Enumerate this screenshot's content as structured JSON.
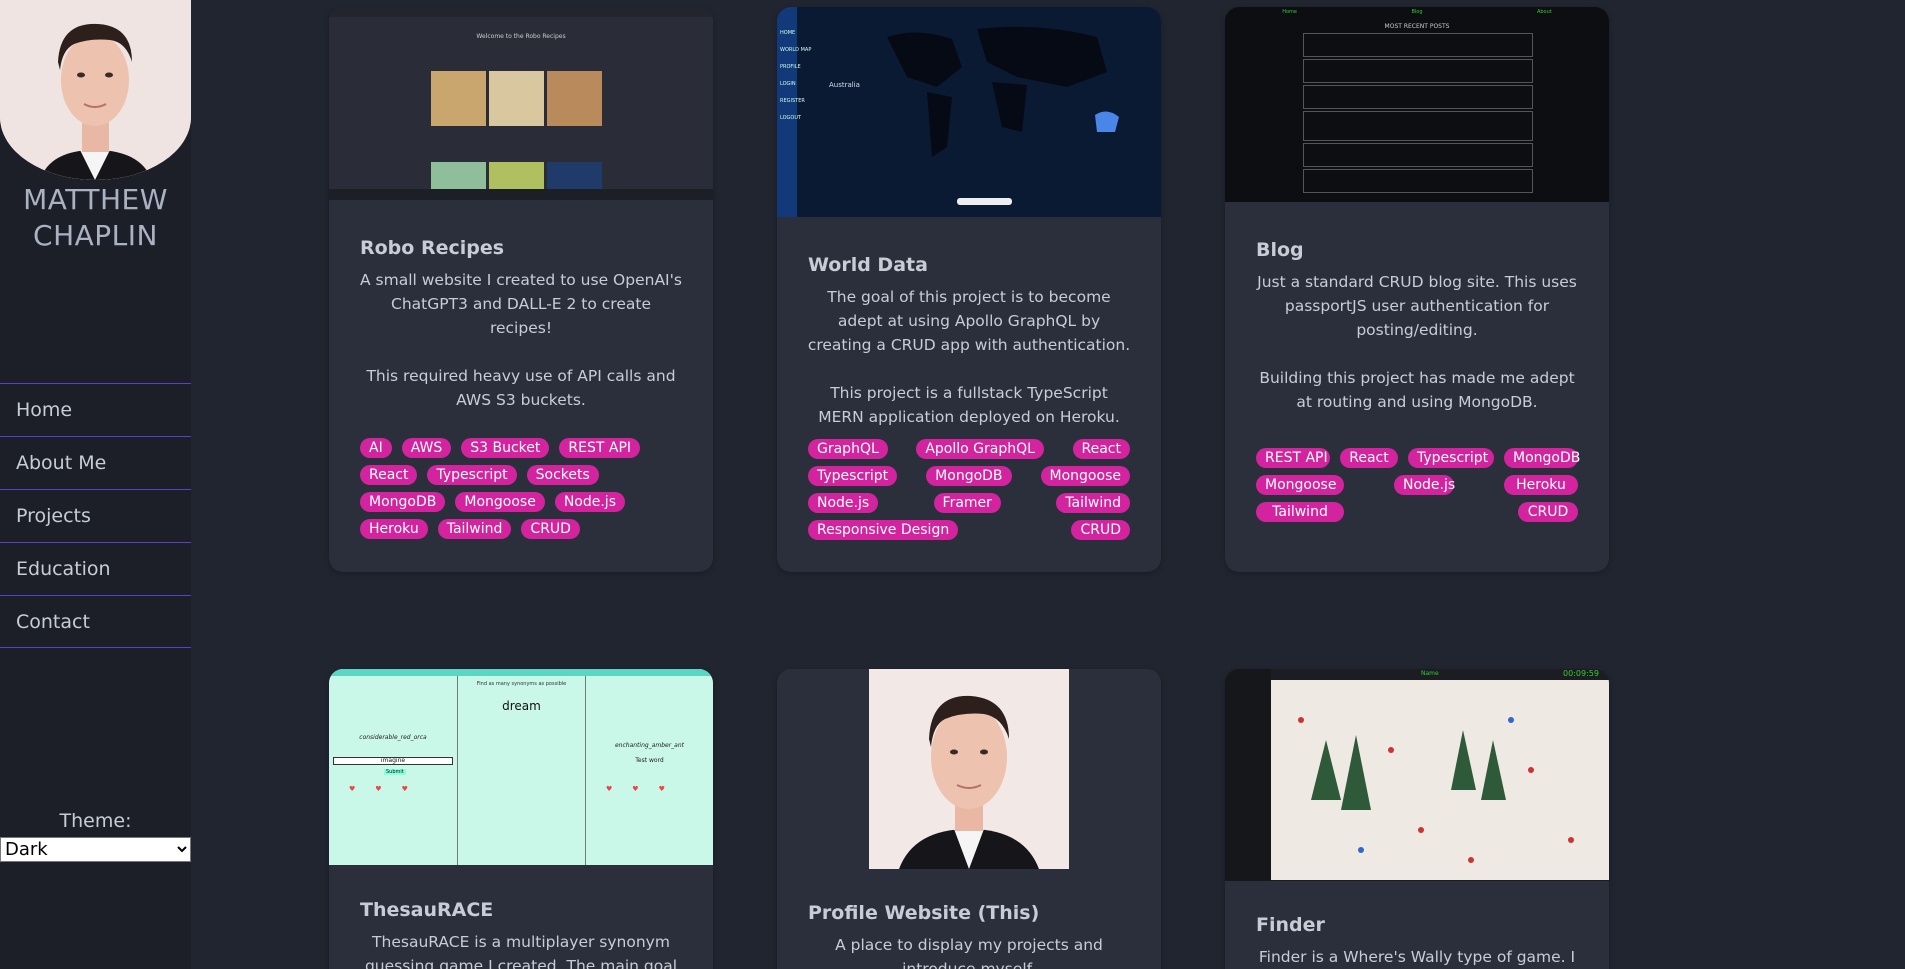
{
  "profile": {
    "name": "MATTHEW CHAPLIN"
  },
  "nav": {
    "items": [
      "Home",
      "About Me",
      "Projects",
      "Education",
      "Contact"
    ]
  },
  "theme": {
    "label": "Theme:",
    "selected": "Dark"
  },
  "projects": [
    {
      "title": "Robo Recipes",
      "desc": "A small website I created to use OpenAI's ChatGPT3 and DALL-E 2 to create recipes!\n\nThis required heavy use of API calls and AWS S3 buckets.",
      "tags": [
        "AI",
        "AWS",
        "S3 Bucket",
        "REST API",
        "React",
        "Typescript",
        "Sockets",
        "MongoDB",
        "Mongoose",
        "Node.js",
        "Heroku",
        "Tailwind",
        "CRUD"
      ],
      "shot": {
        "heading": "Welcome to the Robo Recipes"
      }
    },
    {
      "title": "World Data",
      "desc": "The goal of this project is to become adept at using Apollo GraphQL by creating a CRUD app with authentication.\n\nThis project is a fullstack TypeScript MERN application deployed on Heroku.",
      "tags": [
        "GraphQL",
        "Apollo GraphQL",
        "React",
        "Typescript",
        "MongoDB",
        "Mongoose",
        "Node.js",
        "Framer",
        "Tailwind",
        "Responsive Design",
        "CRUD"
      ],
      "shot": {
        "country": "Australia",
        "menu": [
          "HOME",
          "WORLD MAP",
          "PROFILE",
          "LOGIN",
          "REGISTER",
          "LOGOUT"
        ]
      }
    },
    {
      "title": "Blog",
      "desc": "Just a standard CRUD blog site. This uses passportJS user authentication for posting/editing.\n\nBuilding this project has made me adept at routing and using MongoDB.",
      "tags": [
        "REST API",
        "React",
        "Typescript",
        "MongoDB",
        "Mongoose",
        "Node.js",
        "Heroku",
        "Tailwind",
        "CRUD"
      ],
      "shot": {
        "nav": [
          "Home",
          "Blog",
          "About"
        ],
        "heading": "MOST RECENT POSTS"
      }
    },
    {
      "title": "ThesauRACE",
      "desc": "ThesauRACE is a multiplayer synonym guessing game I created. The main goal of",
      "tags": [],
      "shot": {
        "prompt": "Find as many synonyms as possible",
        "word": "dream",
        "left_player": "considerable_red_orca",
        "right_player": "enchanting_amber_ant",
        "input": "imagine",
        "right_word": "Test word",
        "submit": "Submit"
      }
    },
    {
      "title": "Profile Website (This)",
      "desc": "A place to display my projects and introduce myself.",
      "tags": [],
      "shot": {}
    },
    {
      "title": "Finder",
      "desc": "Finder is a Where's Wally type of game. I",
      "tags": [],
      "shot": {
        "timer": "00:09:59",
        "name_label": "Name"
      }
    }
  ],
  "colors": {
    "accent": "#5b3ecc",
    "tag": "#d4239f",
    "card": "#2b2f3b",
    "background": "#212530"
  }
}
